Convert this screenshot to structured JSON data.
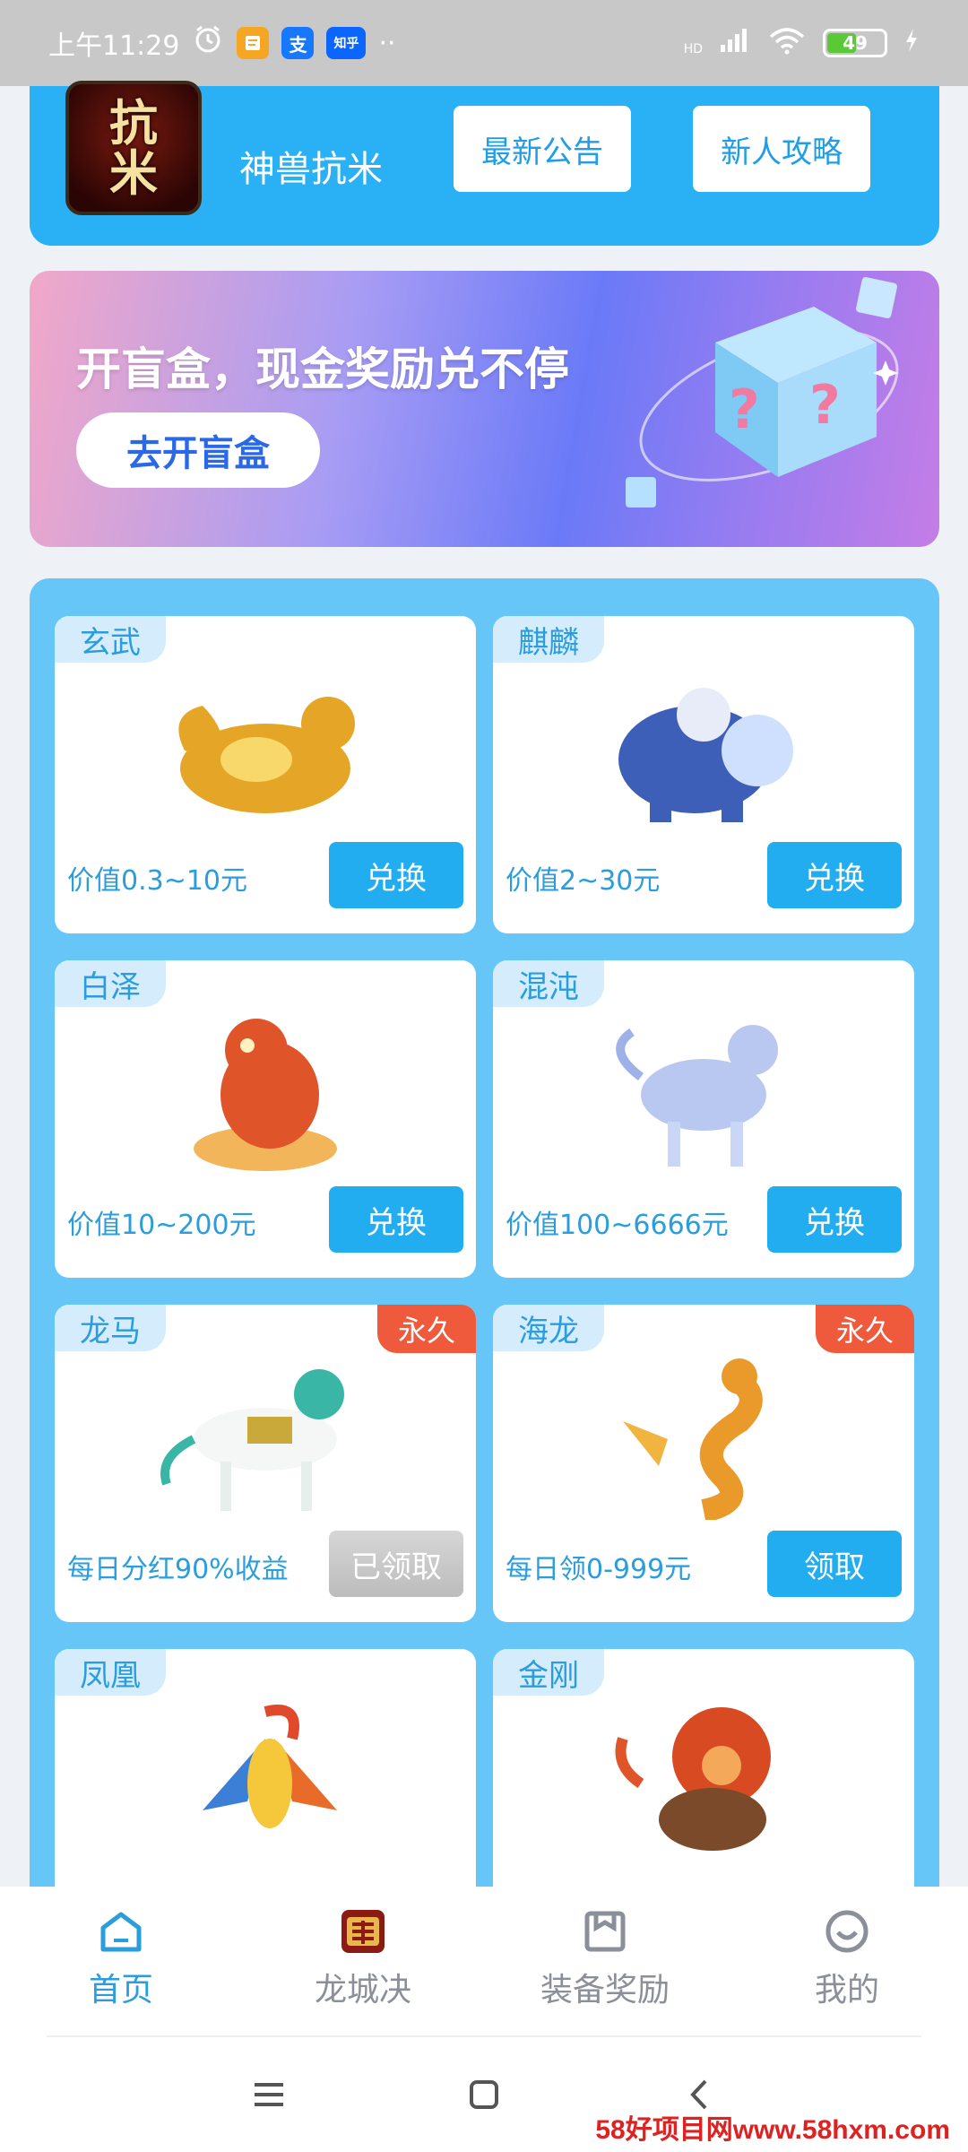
{
  "status_bar": {
    "time": "上午11:29",
    "battery": "49",
    "app_icons": [
      "alarm-icon",
      "notes-icon",
      "alipay-icon",
      "zhihu-icon"
    ],
    "alipay_glyph": "支",
    "zhihu_label": "知乎",
    "more": "··",
    "network": "HD"
  },
  "header": {
    "logo_text_1": "抗",
    "logo_text_2": "米",
    "game_name": "神兽抗米",
    "notice_button": "最新公告",
    "guide_button": "新人攻略"
  },
  "banner": {
    "title": "开盲盒，现金奖励兑不停",
    "button": "去开盲盒"
  },
  "cards": [
    {
      "name": "玄武",
      "value": "价值0.3~10元",
      "button": "兑换",
      "permanent": "",
      "color": "#e5a628"
    },
    {
      "name": "麒麟",
      "value": "价值2~30元",
      "button": "兑换",
      "permanent": "",
      "color": "#3e5fb8"
    },
    {
      "name": "白泽",
      "value": "价值10~200元",
      "button": "兑换",
      "permanent": "",
      "color": "#e0542a"
    },
    {
      "name": "混沌",
      "value": "价值100~6666元",
      "button": "兑换",
      "permanent": "",
      "color": "#b9c8f0"
    },
    {
      "name": "龙马",
      "value": "每日分红90%收益",
      "button": "已领取",
      "permanent": "永久",
      "color": "#39b6a6"
    },
    {
      "name": "海龙",
      "value": "每日领0-999元",
      "button": "领取",
      "permanent": "永久",
      "color": "#e99a2a"
    },
    {
      "name": "凤凰",
      "value": "",
      "button": "",
      "permanent": "",
      "color": "#3b7fd6"
    },
    {
      "name": "金刚",
      "value": "",
      "button": "",
      "permanent": "",
      "color": "#d84a22"
    }
  ],
  "tabbar": {
    "tabs": [
      {
        "label": "首页",
        "icon": "home-icon",
        "active": true
      },
      {
        "label": "龙城决",
        "icon": "game-icon",
        "active": false
      },
      {
        "label": "装备奖励",
        "icon": "bag-icon",
        "active": false
      },
      {
        "label": "我的",
        "icon": "profile-icon",
        "active": false
      }
    ]
  },
  "watermark": "58好项目网www.58hxm.com"
}
